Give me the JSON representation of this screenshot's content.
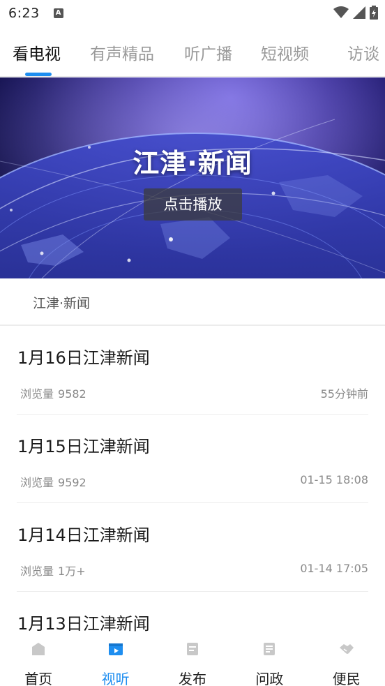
{
  "status_bar": {
    "time": "6:23",
    "a_badge": "A"
  },
  "tabs": [
    {
      "label": "看电视",
      "active": true
    },
    {
      "label": "有声精品",
      "active": false
    },
    {
      "label": "听广播",
      "active": false
    },
    {
      "label": "短视频",
      "active": false
    },
    {
      "label": "访谈",
      "active": false
    }
  ],
  "banner": {
    "title": "江津·新闻",
    "play_label": "点击播放"
  },
  "section": {
    "label": "江津·新闻"
  },
  "news": [
    {
      "title": "1月16日江津新闻",
      "views_label": "浏览量",
      "views": "9582",
      "time": "55分钟前"
    },
    {
      "title": "1月15日江津新闻",
      "views_label": "浏览量",
      "views": "9592",
      "time": "01-15 18:08"
    },
    {
      "title": "1月14日江津新闻",
      "views_label": "浏览量",
      "views": "1万+",
      "time": "01-14 17:05"
    },
    {
      "title": "1月13日江津新闻",
      "views_label": "",
      "views": "",
      "time": ""
    }
  ],
  "bottom_nav": [
    {
      "label": "首页",
      "icon": "home-icon",
      "active": false
    },
    {
      "label": "视听",
      "icon": "video-icon",
      "active": true
    },
    {
      "label": "发布",
      "icon": "publish-icon",
      "active": false
    },
    {
      "label": "问政",
      "icon": "document-icon",
      "active": false
    },
    {
      "label": "便民",
      "icon": "handshake-icon",
      "active": false
    }
  ],
  "colors": {
    "accent": "#1e8ef0",
    "inactive_icon": "#c8c8c8"
  }
}
